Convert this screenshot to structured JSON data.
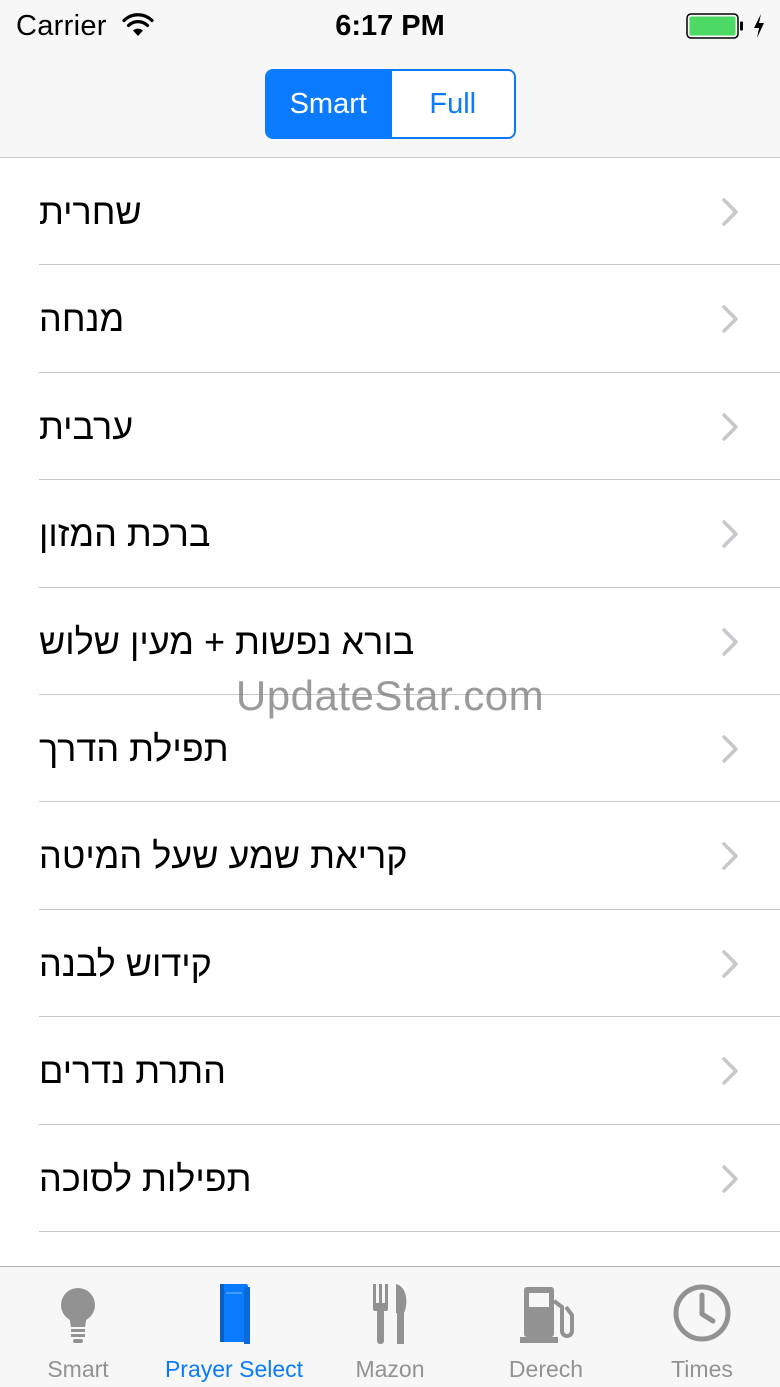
{
  "status_bar": {
    "carrier": "Carrier",
    "time": "6:17 PM"
  },
  "segmented_control": {
    "options": [
      "Smart",
      "Full"
    ],
    "selected": "Smart"
  },
  "prayers": [
    {
      "label": "שחרית"
    },
    {
      "label": "מנחה"
    },
    {
      "label": "ערבית"
    },
    {
      "label": "ברכת המזון"
    },
    {
      "label": "בורא נפשות + מעין שלוש"
    },
    {
      "label": "תפילת הדרך"
    },
    {
      "label": "קריאת שמע שעל המיטה"
    },
    {
      "label": "קידוש לבנה"
    },
    {
      "label": "התרת נדרים"
    },
    {
      "label": "תפילות לסוכה"
    }
  ],
  "watermark": "UpdateStar.com",
  "tab_bar": {
    "selected": "Prayer Select",
    "tabs": [
      {
        "label": "Smart",
        "icon": "lightbulb-icon"
      },
      {
        "label": "Prayer Select",
        "icon": "book-icon"
      },
      {
        "label": "Mazon",
        "icon": "fork-knife-icon"
      },
      {
        "label": "Derech",
        "icon": "gas-pump-icon"
      },
      {
        "label": "Times",
        "icon": "clock-icon"
      }
    ]
  },
  "colors": {
    "accent": "#0a7aff",
    "inactive_tab": "#929292",
    "battery": "#4cd964",
    "separator": "#c8c7cc"
  }
}
